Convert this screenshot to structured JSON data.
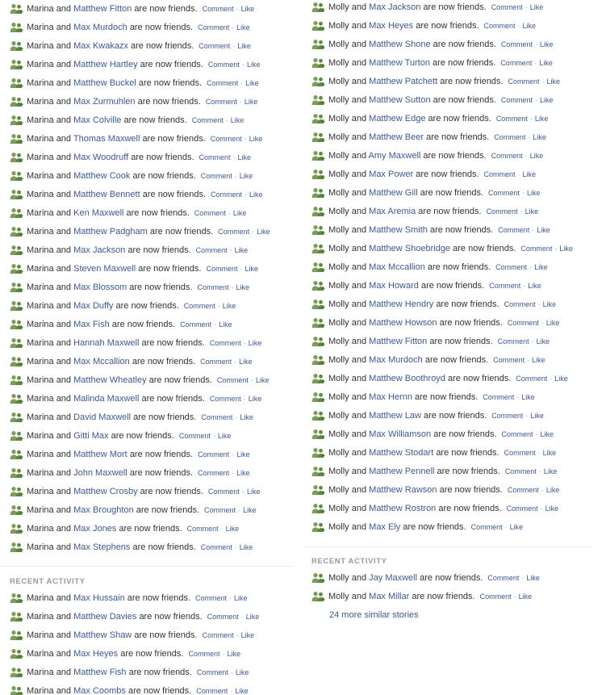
{
  "common": {
    "connector": "and",
    "suffix": "are now friends.",
    "comment_label": "Comment",
    "like_label": "Like",
    "separator": "·",
    "icon_name": "friends-icon"
  },
  "left": {
    "actor": "Marina",
    "friends": [
      "Matthew Fitton",
      "Max Murdoch",
      "Max Kwakazx",
      "Matthew Hartley",
      "Matthew Buckel",
      "Max Zurmuhlen",
      "Max Colville",
      "Thomas Maxwell",
      "Max Woodruff",
      "Matthew Cook",
      "Matthew Bennett",
      "Ken Maxwell",
      "Matthew Padgham",
      "Max Jackson",
      "Steven Maxwell",
      "Max Blossom",
      "Max Duffy",
      "Max Fish",
      "Hannah Maxwell",
      "Max Mccallion",
      "Matthew Wheatley",
      "Malinda Maxwell",
      "David Maxwell",
      "Gitti Max",
      "Matthew Mort",
      "John Maxwell",
      "Matthew Crosby",
      "Max Broughton",
      "Max Jones",
      "Max Stephens"
    ],
    "recent_title": "Recent Activity",
    "recent": [
      "Max Hussain",
      "Matthew Davies",
      "Matthew Shaw",
      "Max Heyes",
      "Matthew Fish",
      "Max Coombs"
    ]
  },
  "right": {
    "actor": "Molly",
    "friends": [
      "Max Jackson",
      "Max Heyes",
      "Matthew Shone",
      "Matthew Turton",
      "Matthew Patchett",
      "Matthew Sutton",
      "Matthew Edge",
      "Matthew Beer",
      "Amy Maxwell",
      "Max Power",
      "Matthew Gill",
      "Max Aremia",
      "Matthew Smith",
      "Matthew Shoebridge",
      "Max Mccallion",
      "Max Howard",
      "Matthew Hendry",
      "Matthew Howson",
      "Matthew Fitton",
      "Max Murdoch",
      "Matthew Boothroyd",
      "Max Hernn",
      "Matthew Law",
      "Max Williamson",
      "Matthew Stodart",
      "Matthew Pennell",
      "Matthew Rawson",
      "Matthew Rostron",
      "Max Ely"
    ],
    "recent_title": "Recent Activity",
    "recent": [
      "Jay Maxwell",
      "Max Millar"
    ],
    "more_link": "24 more similar stories"
  }
}
